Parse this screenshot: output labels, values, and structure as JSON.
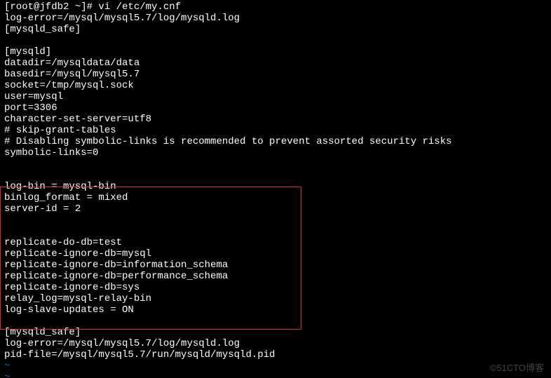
{
  "prompt": "[root@jfdb2 ~]# vi /etc/my.cnf",
  "config": {
    "before": [
      "log-error=/mysql/mysql5.7/log/mysqld.log",
      "[mysqld_safe]",
      "",
      "[mysqld]",
      "datadir=/mysqldata/data",
      "basedir=/mysql/mysql5.7",
      "socket=/tmp/mysql.sock",
      "user=mysql",
      "port=3306",
      "character-set-server=utf8",
      "# skip-grant-tables",
      "# Disabling symbolic-links is recommended to prevent assorted security risks",
      "symbolic-links=0",
      "",
      ""
    ],
    "boxed": [
      "log-bin = mysql-bin",
      "binlog_format = mixed",
      "server-id = 2",
      "",
      "",
      "replicate-do-db=test",
      "replicate-ignore-db=mysql",
      "replicate-ignore-db=information_schema",
      "replicate-ignore-db=performance_schema",
      "replicate-ignore-db=sys",
      "relay_log=mysql-relay-bin",
      "log-slave-updates = ON"
    ],
    "after": [
      "",
      "[mysqld_safe]",
      "log-error=/mysql/mysql5.7/log/mysqld.log",
      "pid-file=/mysql/mysql5.7/run/mysqld/mysqld.pid"
    ]
  },
  "tilde": "~",
  "watermark": "©51CTO博客"
}
